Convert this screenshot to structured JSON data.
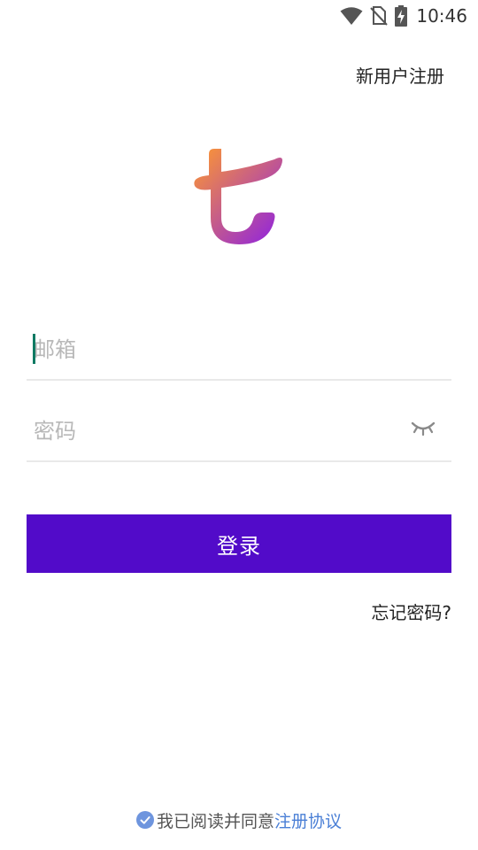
{
  "status_bar": {
    "time": "10:46",
    "icons": [
      "wifi-icon",
      "no-sim-icon",
      "battery-charging-icon"
    ]
  },
  "header": {
    "register_label": "新用户注册"
  },
  "logo": {
    "icon": "app-logo-icon",
    "gradient_start": "#ff9a2e",
    "gradient_end": "#8b1ee6"
  },
  "form": {
    "email_placeholder": "邮箱",
    "email_value": "",
    "password_placeholder": "密码",
    "password_value": "",
    "password_toggle_icon": "eye-closed-icon"
  },
  "login_button": {
    "label": "登录",
    "color": "#520bc9"
  },
  "forgot_password_label": "忘记密码?",
  "agreement": {
    "checked": true,
    "prefix": "我已阅读并同意",
    "link_label": "注册协议",
    "link_color": "#4a7fd6",
    "check_color": "#6e95de"
  }
}
